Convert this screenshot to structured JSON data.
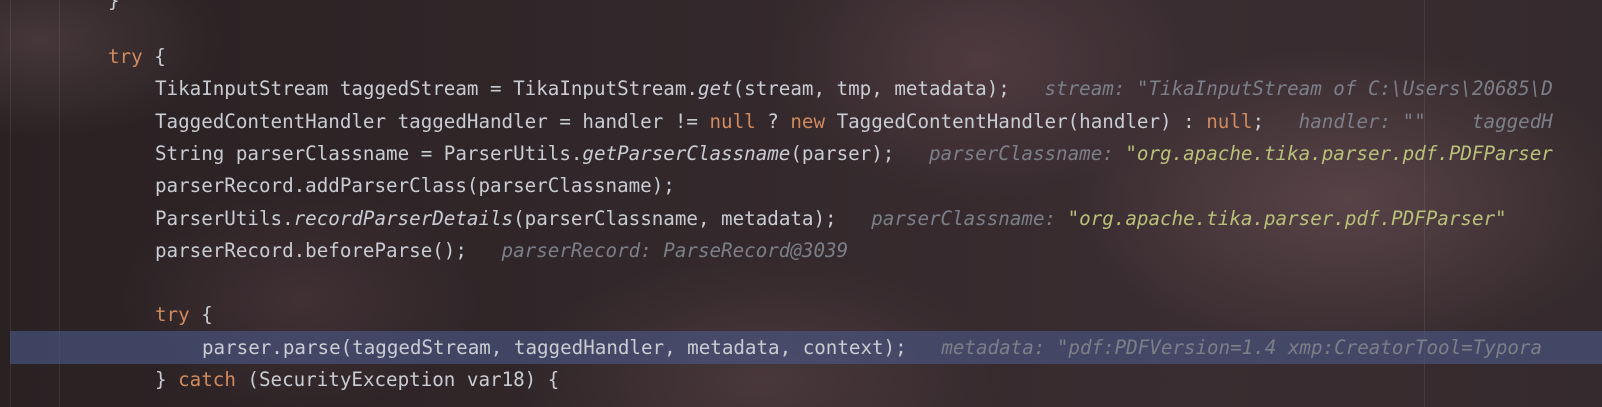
{
  "editor": {
    "top_fragment": "}",
    "lines": [
      {
        "segments": [
          {
            "t": "try",
            "c": "kw"
          },
          {
            "t": " {",
            "c": ""
          }
        ]
      },
      {
        "segments": [
          {
            "t": "TikaInputStream taggedStream = TikaInputStream.",
            "c": ""
          },
          {
            "t": "get",
            "c": "m"
          },
          {
            "t": "(stream, tmp, metadata);",
            "c": ""
          },
          {
            "t": "   stream: \"TikaInputStream of C:\\Users\\20685\\D",
            "c": "inl"
          }
        ]
      },
      {
        "segments": [
          {
            "t": "TaggedContentHandler taggedHandler = handler != ",
            "c": ""
          },
          {
            "t": "null",
            "c": "kw"
          },
          {
            "t": " ? ",
            "c": ""
          },
          {
            "t": "new",
            "c": "kw"
          },
          {
            "t": " TaggedContentHandler(handler) : ",
            "c": ""
          },
          {
            "t": "null",
            "c": "kw"
          },
          {
            "t": ";",
            "c": ""
          },
          {
            "t": "   handler: \"\"    taggedH",
            "c": "inl"
          }
        ]
      },
      {
        "segments": [
          {
            "t": "String parserClassname = ParserUtils.",
            "c": ""
          },
          {
            "t": "getParserClassname",
            "c": "m"
          },
          {
            "t": "(parser);",
            "c": ""
          },
          {
            "t": "   parserClassname: ",
            "c": "inl"
          },
          {
            "t": "\"org.apache.tika.parser.pdf.PDFParser",
            "c": "str"
          }
        ]
      },
      {
        "segments": [
          {
            "t": "parserRecord.addParserClass(parserClassname);",
            "c": ""
          }
        ]
      },
      {
        "segments": [
          {
            "t": "ParserUtils.",
            "c": ""
          },
          {
            "t": "recordParserDetails",
            "c": "m"
          },
          {
            "t": "(parserClassname, metadata);",
            "c": ""
          },
          {
            "t": "   parserClassname: ",
            "c": "inl"
          },
          {
            "t": "\"org.apache.tika.parser.pdf.PDFParser\"",
            "c": "str"
          }
        ]
      },
      {
        "segments": [
          {
            "t": "parserRecord.beforeParse();",
            "c": ""
          },
          {
            "t": "   parserRecord: ParseRecord@3039",
            "c": "inl"
          }
        ]
      },
      {
        "segments": []
      },
      {
        "segments": [
          {
            "t": "try",
            "c": "kw"
          },
          {
            "t": " {",
            "c": ""
          }
        ]
      },
      {
        "segments": [
          {
            "t": "parser.parse(taggedStream, taggedHandler, metadata, context);",
            "c": ""
          },
          {
            "t": "   metadata: \"pdf:PDFVersion=1.4 xmp:CreatorTool=Typora",
            "c": "inl"
          }
        ]
      },
      {
        "segments": [
          {
            "t": "} ",
            "c": ""
          },
          {
            "t": "catch",
            "c": "kw"
          },
          {
            "t": " (SecurityException var18) {",
            "c": ""
          }
        ]
      }
    ]
  }
}
